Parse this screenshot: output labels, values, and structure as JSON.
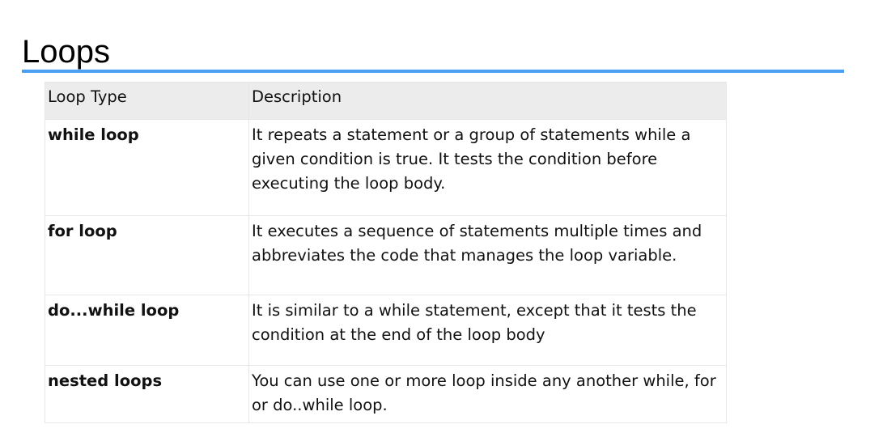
{
  "slide": {
    "title": "Loops"
  },
  "table": {
    "columns": [
      "Loop Type",
      "Description"
    ],
    "rows": [
      {
        "type": "while loop",
        "description": "It repeats a statement or a group of statements while a given condition is true. It tests the condition before executing the loop body."
      },
      {
        "type": "for loop",
        "description": "It executes a sequence of statements multiple times and abbreviates the code that manages the loop variable."
      },
      {
        "type": "do...while loop",
        "description": "It is similar to a while statement, except that it tests the condition at the end of the loop body"
      },
      {
        "type": "nested loops",
        "description": "You can use one or more loop inside any another while, for or do..while loop."
      }
    ]
  },
  "colors": {
    "title_rule": "#4a9ff0",
    "header_bg": "#ececec",
    "border": "#e6e6e6"
  }
}
